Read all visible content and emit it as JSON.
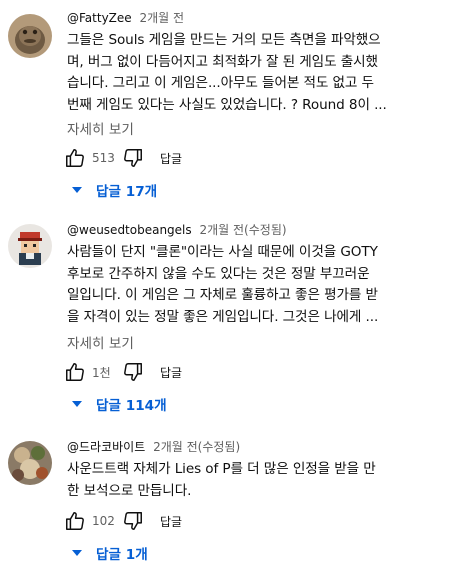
{
  "comments": [
    {
      "author": "@FattyZee",
      "time": "2개월 전",
      "lines": [
        "그들은 Souls 게임을 만드는 거의 모든 측면을 파악했으",
        "며, 버그 없이 다듬어지고 최적화가 잘 된 게임도 출시했",
        "습니다. 그리고 이 게임은...아무도 들어본 적도 없고 두",
        "번째 게임도 있다는 사실도 있었습니다. ? Round 8이 ..."
      ],
      "more": "자세히 보기",
      "likes": "513",
      "reply_label": "답글",
      "replies_label": "답글 17개"
    },
    {
      "author": "@weusedtobeangels",
      "time": "2개월 전(수정됨)",
      "lines": [
        "사람들이 단지 \"클론\"이라는 사실 때문에 이것을 GOTY",
        "후보로 간주하지 않을 수도 있다는 것은 정말 부끄러운",
        "일입니다. 이 게임은 그 자체로 훌륭하고 좋은 평가를 받",
        "을 자격이 있는 정말 좋은 게임입니다. 그것은 나에게 ..."
      ],
      "more": "자세히 보기",
      "likes": "1천",
      "reply_label": "답글",
      "replies_label": "답글 114개"
    },
    {
      "author": "@드라코바이트",
      "time": "2개월 전(수정됨)",
      "lines": [
        "사운드트랙 자체가 Lies of P를 더 많은 인정을 받을 만",
        "한 보석으로 만듭니다."
      ],
      "likes": "102",
      "reply_label": "답글",
      "replies_label": "답글 1개"
    }
  ],
  "colors": {
    "link_blue": "#065fd4",
    "secondary_text": "#606060",
    "primary_text": "#0f0f0f"
  },
  "icons": {
    "like": "thumbs-up-icon",
    "dislike": "thumbs-down-icon",
    "expand": "caret-down-icon"
  }
}
